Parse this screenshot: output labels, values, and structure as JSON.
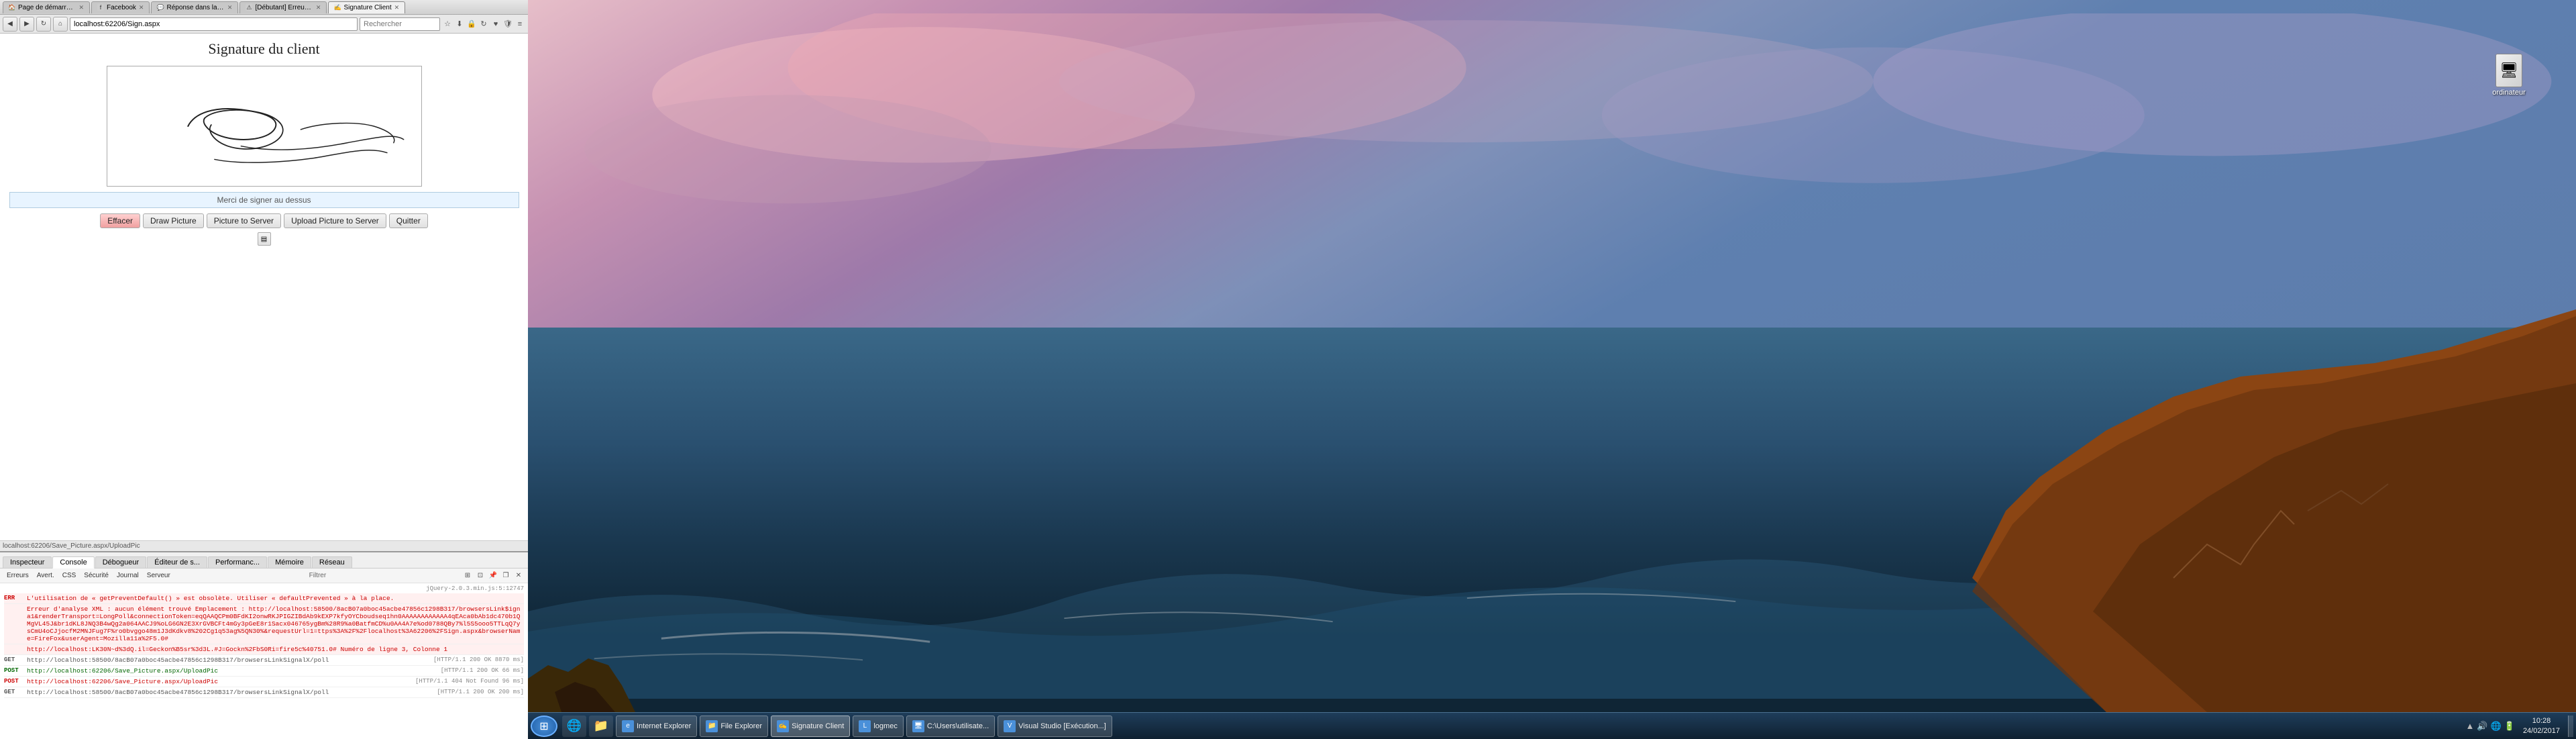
{
  "browser": {
    "tabs": [
      {
        "label": "Page de démarrage de M...",
        "active": false,
        "favicon": "🏠"
      },
      {
        "label": "Facebook",
        "active": false,
        "favicon": "f"
      },
      {
        "label": "Réponse dans la discussion...",
        "active": false,
        "favicon": "💬"
      },
      {
        "label": "[Débutant] Erreur de comp...",
        "active": false,
        "favicon": "⚠"
      },
      {
        "label": "Signature Client",
        "active": true,
        "favicon": "✍"
      }
    ],
    "address": "localhost:62206/Sign.aspx",
    "search_placeholder": "Rechercher",
    "nav_buttons": {
      "back": "◀",
      "forward": "▶",
      "refresh": "↻",
      "home": "⌂"
    },
    "page": {
      "title": "Signature du client",
      "sign_instruction": "Merci de signer au dessus",
      "buttons": [
        {
          "label": "Effacer",
          "class": "btn-effacer"
        },
        {
          "label": "Draw Picture"
        },
        {
          "label": "Picture to Server"
        },
        {
          "label": "Upload Picture to Server"
        },
        {
          "label": "Quitter"
        }
      ]
    }
  },
  "status_bar": {
    "url": "localhost:62206/Save_Picture.aspx/UploadPic"
  },
  "devtools": {
    "tabs": [
      "Inspecteur",
      "Console",
      "Débogueur",
      "Éditeur de s...",
      "Performanc...",
      "Mémoire",
      "Réseau"
    ],
    "active_tab": "Console",
    "toolbar_items": [
      "Erreurs",
      "Avert.",
      "CSS",
      "Sécurité",
      "Journal",
      "Serveur"
    ],
    "filter_label": "Filtrer",
    "jquery_version": "jQuery-2.0.3.min.js:5:12747",
    "console_rows": [
      {
        "type": "ERR",
        "class": "error",
        "msg": "L'utilisation de « getPreventDefault() » est obsolète. Utiliser « defaultPrevented » à la place.",
        "source": ""
      },
      {
        "type": "",
        "class": "error",
        "msg": "Erreur d'analyse XML : aucun élément trouvé Emplacement : http://localhost:58500/8acB07a0boc45acbe47856c1298B317/browsersLink$igna1&renderTransport=LongPoll&connectionToken=eqQAAQCPm0BFdKI2onwRKJPIGZIBdAb9kEXP7kfyOYCboudseq1hn0AAAAAAAAAAAA4qEAca0bAb1dc470b1QMgVL45J&br1dKL8JNQ3B4wQg2a064AACJ9%oLG6GN2E3XrGVBCFt4mGy3pGeE8r1Sacx046765ygBm%28R9%a0BatfmCD%u0AA4A7e%od0788QBy7%l5S5ooo5TTLqQ7ysCmU4oCJjocfM2MNJFug7F%ro0bvggo48m1J3dKdkv8%202Cg1q53ag%5QN30%&requestUrl=1=ttps%3A%2F%2Flocalhost%3A62206%2FSign.aspx&browserName=FireFox&userAgent=Mozilla11a%2F5.0#",
        "source": ""
      },
      {
        "type": "",
        "class": "error",
        "msg": "http://localhost:LK30N~d%3dQ.il=Geckon%B5sr%3d3L.#J=Gockn%2FbS0Ri=fire5c%40751.0# Numéro de ligne 3, Colonne 1",
        "source": ""
      },
      {
        "type": "GET",
        "class": "net-get",
        "msg": "http://localhost:58500/8acB07a0boc45acbe47856c1298B317/browsersLinkSignalX/poll",
        "status": "[HTTP/1.1 200 OK 8870 ms]"
      },
      {
        "type": "POST",
        "class": "net-post",
        "msg": "http://localhost:62206/Save_Picture.aspx/UploadPic",
        "status": "[HTTP/1.1 200 OK 66 ms]"
      },
      {
        "type": "POST",
        "class": "net-post-err",
        "msg": "http://localhost:62206/Save_Picture.aspx/UploadPic",
        "status": "[HTTP/1.1 404 Not Found 96 ms]"
      },
      {
        "type": "GET",
        "class": "net-get",
        "msg": "http://localhost:58500/8acB07a0boc45acbe47856c1298B317/browsersLinkSignalX/poll",
        "status": "[HTTP/1.1 200 OK 200 ms]"
      }
    ]
  },
  "desktop": {
    "icon": {
      "label": "ordinateur",
      "symbol": "🖥"
    }
  },
  "taskbar": {
    "apps": [
      {
        "label": "Internet Explorer",
        "icon": "e",
        "active": false
      },
      {
        "label": "File Explorer",
        "icon": "📁",
        "active": false
      },
      {
        "label": "Signature Client",
        "icon": "✍",
        "active": true
      },
      {
        "label": "logmec",
        "icon": "L",
        "active": false
      },
      {
        "label": "C:\\Users\\utilisate...",
        "icon": "🖥",
        "active": false
      },
      {
        "label": "Visual Studio [Exécution...]",
        "icon": "V",
        "active": false
      }
    ],
    "tray_icons": [
      "🔊",
      "🌐",
      "🔋",
      "📶"
    ],
    "time": "10:28",
    "date": "24/02/2017"
  }
}
